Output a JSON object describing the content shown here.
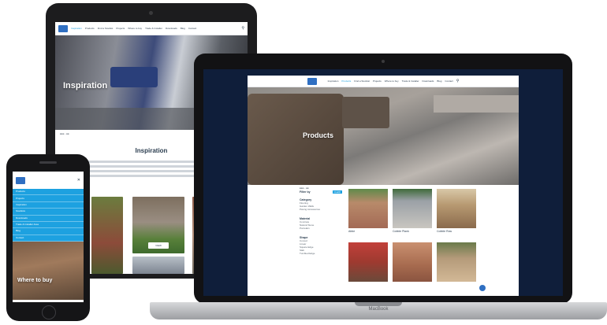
{
  "nav": {
    "items": [
      "Inspiration",
      "Products",
      "Find a Stockist",
      "Projects",
      "Where to buy",
      "Trade & Installer",
      "Downloads",
      "Blog",
      "Contact"
    ]
  },
  "tablet": {
    "hero_title": "Inspiration",
    "section_title": "Inspiration",
    "cta_label": "VIEW"
  },
  "laptop": {
    "hero_title": "Products",
    "filter_label": "Filter by",
    "filter_clear": "CLEAR",
    "groups": [
      {
        "title": "Category",
        "items": [
          "Flooring",
          "Garden Walls",
          "Paving Accessories"
        ]
      },
      {
        "title": "Material",
        "items": [
          "Concrete",
          "Natural Stone",
          "Porcelain"
        ]
      },
      {
        "title": "Shape",
        "items": [
          "Curved",
          "Linear",
          "Square Edge",
          "Slab",
          "Tumbled Edge"
        ]
      }
    ],
    "products": [
      {
        "name": "Abbe"
      },
      {
        "name": "Cobble Plank"
      },
      {
        "name": "Cobble Row"
      },
      {
        "name": ""
      },
      {
        "name": ""
      },
      {
        "name": ""
      }
    ],
    "base_brand": "MacBook"
  },
  "phone": {
    "menu_items": [
      "Products",
      "Projects",
      "Inspiration",
      "Stockists",
      "Downloads",
      "Trade & Installer Area",
      "Blog",
      "Contact"
    ],
    "hero_title": "Where to buy"
  },
  "colors": {
    "accent": "#1da1e0",
    "brand": "#2f6fc2",
    "laptop_bezel": "#0f1e3a"
  }
}
